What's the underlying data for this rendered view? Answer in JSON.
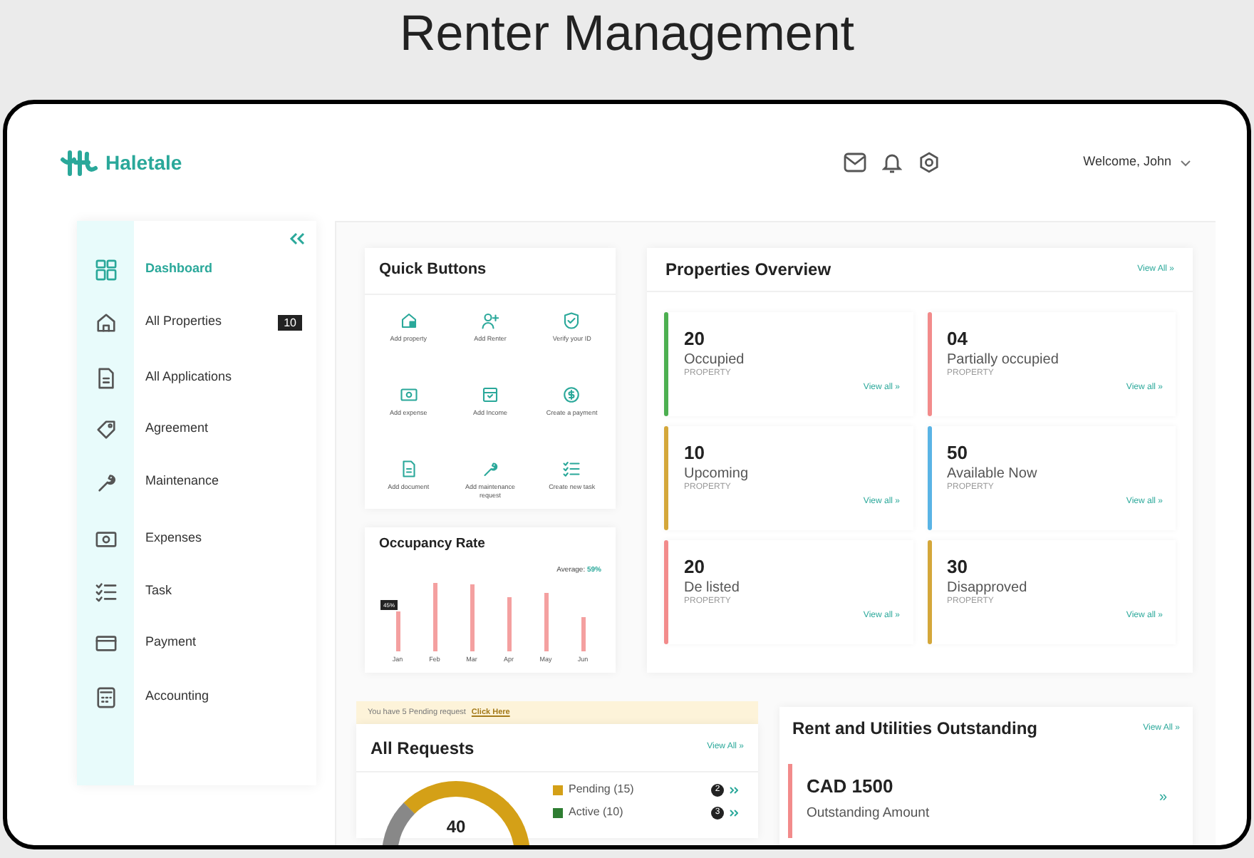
{
  "slide_title": "Renter Management",
  "header": {
    "brand": "Haletale",
    "welcome": "Welcome, John"
  },
  "sidebar": {
    "items": [
      {
        "label": "Dashboard",
        "selected": true,
        "kind": "dashboard"
      },
      {
        "label": "All Properties",
        "selected": false,
        "kind": "home",
        "badge": "10"
      },
      {
        "label": "All Applications",
        "selected": false,
        "kind": "doc"
      },
      {
        "label": "Agreement",
        "selected": false,
        "kind": "tag"
      },
      {
        "label": "Maintenance",
        "selected": false,
        "kind": "wrench"
      },
      {
        "label": "Expenses",
        "selected": false,
        "kind": "cash"
      },
      {
        "label": "Task",
        "selected": false,
        "kind": "list"
      },
      {
        "label": "Payment",
        "selected": false,
        "kind": "card"
      },
      {
        "label": "Accounting",
        "selected": false,
        "kind": "calc"
      }
    ]
  },
  "quick_buttons": {
    "title": "Quick Buttons",
    "items": [
      {
        "label": "Add property",
        "kind": "house"
      },
      {
        "label": "Add Renter",
        "kind": "user"
      },
      {
        "label": "Verify your ID",
        "kind": "shield"
      },
      {
        "label": "Add expense",
        "kind": "cash"
      },
      {
        "label": "Add Income",
        "kind": "calendar"
      },
      {
        "label": "Create a payment",
        "kind": "dollar"
      },
      {
        "label": "Add document",
        "kind": "doc"
      },
      {
        "label": "Add maintenance request",
        "kind": "wrench"
      },
      {
        "label": "Create new task",
        "kind": "list"
      }
    ]
  },
  "occupancy": {
    "title": "Occupancy Rate",
    "average_label": "Average:",
    "average_value": "59%",
    "tooltip": "45%",
    "months": [
      "Jan",
      "Feb",
      "Mar",
      "Apr",
      "May",
      "Jun"
    ]
  },
  "properties_overview": {
    "title": "Properties Overview",
    "view_all": "View All »",
    "cards": [
      {
        "count": "20",
        "label": "Occupied",
        "sublabel": "PROPERTY",
        "link": "View all »",
        "color": "#4caf50"
      },
      {
        "count": "04",
        "label": "Partially occupied",
        "sublabel": "PROPERTY",
        "link": "View all »",
        "color": "#f28b8b"
      },
      {
        "count": "10",
        "label": "Upcoming",
        "sublabel": "PROPERTY",
        "link": "View all »",
        "color": "#d4a73a"
      },
      {
        "count": "50",
        "label": "Available Now",
        "sublabel": "PROPERTY",
        "link": "View all »",
        "color": "#5ab4e5"
      },
      {
        "count": "20",
        "label": "De listed",
        "sublabel": "PROPERTY",
        "link": "View all »",
        "color": "#f28b8b"
      },
      {
        "count": "30",
        "label": "Disapproved",
        "sublabel": "PROPERTY",
        "link": "View all »",
        "color": "#d4a73a"
      }
    ]
  },
  "pending_banner": {
    "text": "You have 5 Pending request",
    "link": "Click Here"
  },
  "all_requests": {
    "title": "All Requests",
    "view_all": "View All »",
    "total": "40",
    "legend": [
      {
        "label": "Pending (15)",
        "count": "2",
        "color": "#d4a017"
      },
      {
        "label": "Active (10)",
        "count": "3",
        "color": "#2e7d32"
      }
    ]
  },
  "rent_outstanding": {
    "title": "Rent and Utilities Outstanding",
    "view_all": "View All »",
    "amount": "CAD 1500",
    "caption": "Outstanding Amount",
    "arrow": "»"
  }
}
